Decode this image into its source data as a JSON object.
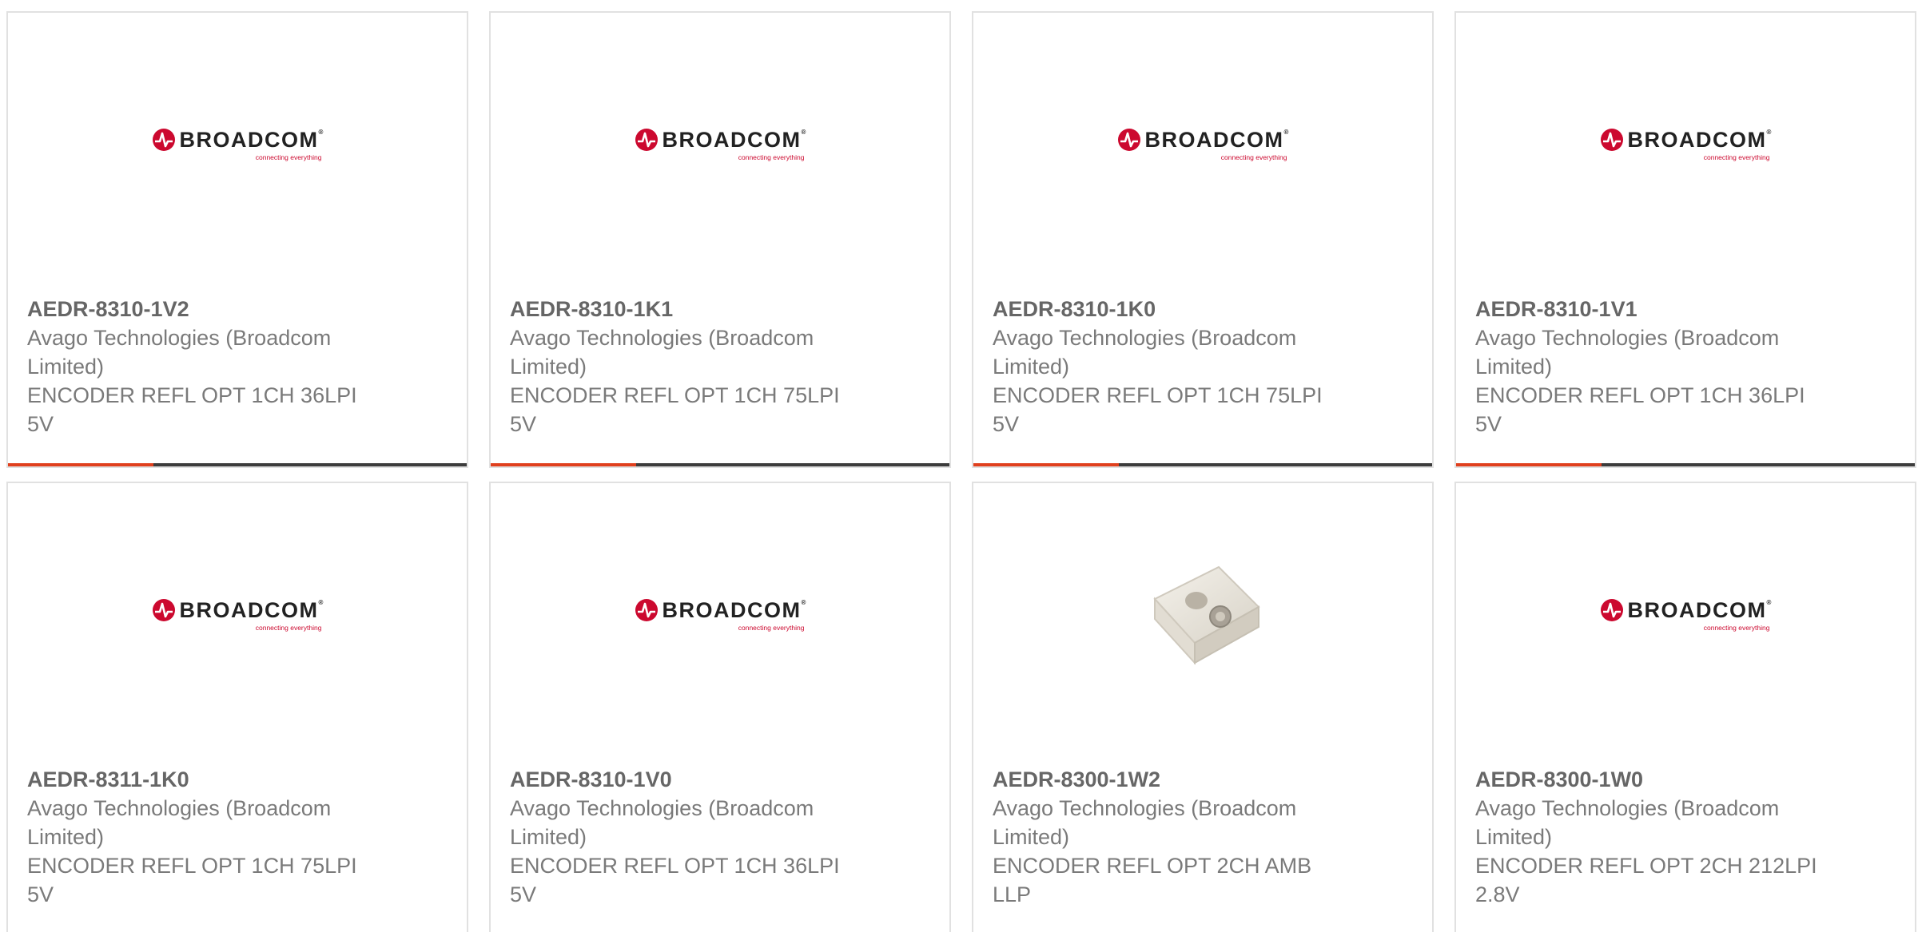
{
  "brand": {
    "logo_word": "BROADCOM",
    "logo_tagline": "connecting everything",
    "colors": {
      "logo_red": "#cc092f",
      "accent_red": "#e0401e",
      "bar_dark": "#3c3c3c"
    }
  },
  "products": [
    {
      "part_number": "AEDR-8310-1V2",
      "manufacturer": "Avago Technologies (Broadcom Limited)",
      "description": "ENCODER REFL OPT 1CH 36LPI 5V",
      "image": "broadcom-logo"
    },
    {
      "part_number": "AEDR-8310-1K1",
      "manufacturer": "Avago Technologies (Broadcom Limited)",
      "description": "ENCODER REFL OPT 1CH 75LPI 5V",
      "image": "broadcom-logo"
    },
    {
      "part_number": "AEDR-8310-1K0",
      "manufacturer": "Avago Technologies (Broadcom Limited)",
      "description": "ENCODER REFL OPT 1CH 75LPI 5V",
      "image": "broadcom-logo"
    },
    {
      "part_number": "AEDR-8310-1V1",
      "manufacturer": "Avago Technologies (Broadcom Limited)",
      "description": "ENCODER REFL OPT 1CH 36LPI 5V",
      "image": "broadcom-logo"
    },
    {
      "part_number": "AEDR-8311-1K0",
      "manufacturer": "Avago Technologies (Broadcom Limited)",
      "description": "ENCODER REFL OPT 1CH 75LPI 5V",
      "image": "broadcom-logo"
    },
    {
      "part_number": "AEDR-8310-1V0",
      "manufacturer": "Avago Technologies (Broadcom Limited)",
      "description": "ENCODER REFL OPT 1CH 36LPI 5V",
      "image": "broadcom-logo"
    },
    {
      "part_number": "AEDR-8300-1W2",
      "manufacturer": "Avago Technologies (Broadcom Limited)",
      "description": "ENCODER REFL OPT 2CH AMB LLP",
      "image": "encoder-chip-photo"
    },
    {
      "part_number": "AEDR-8300-1W0",
      "manufacturer": "Avago Technologies (Broadcom Limited)",
      "description": "ENCODER REFL OPT 2CH 212LPI 2.8V",
      "image": "broadcom-logo"
    }
  ]
}
